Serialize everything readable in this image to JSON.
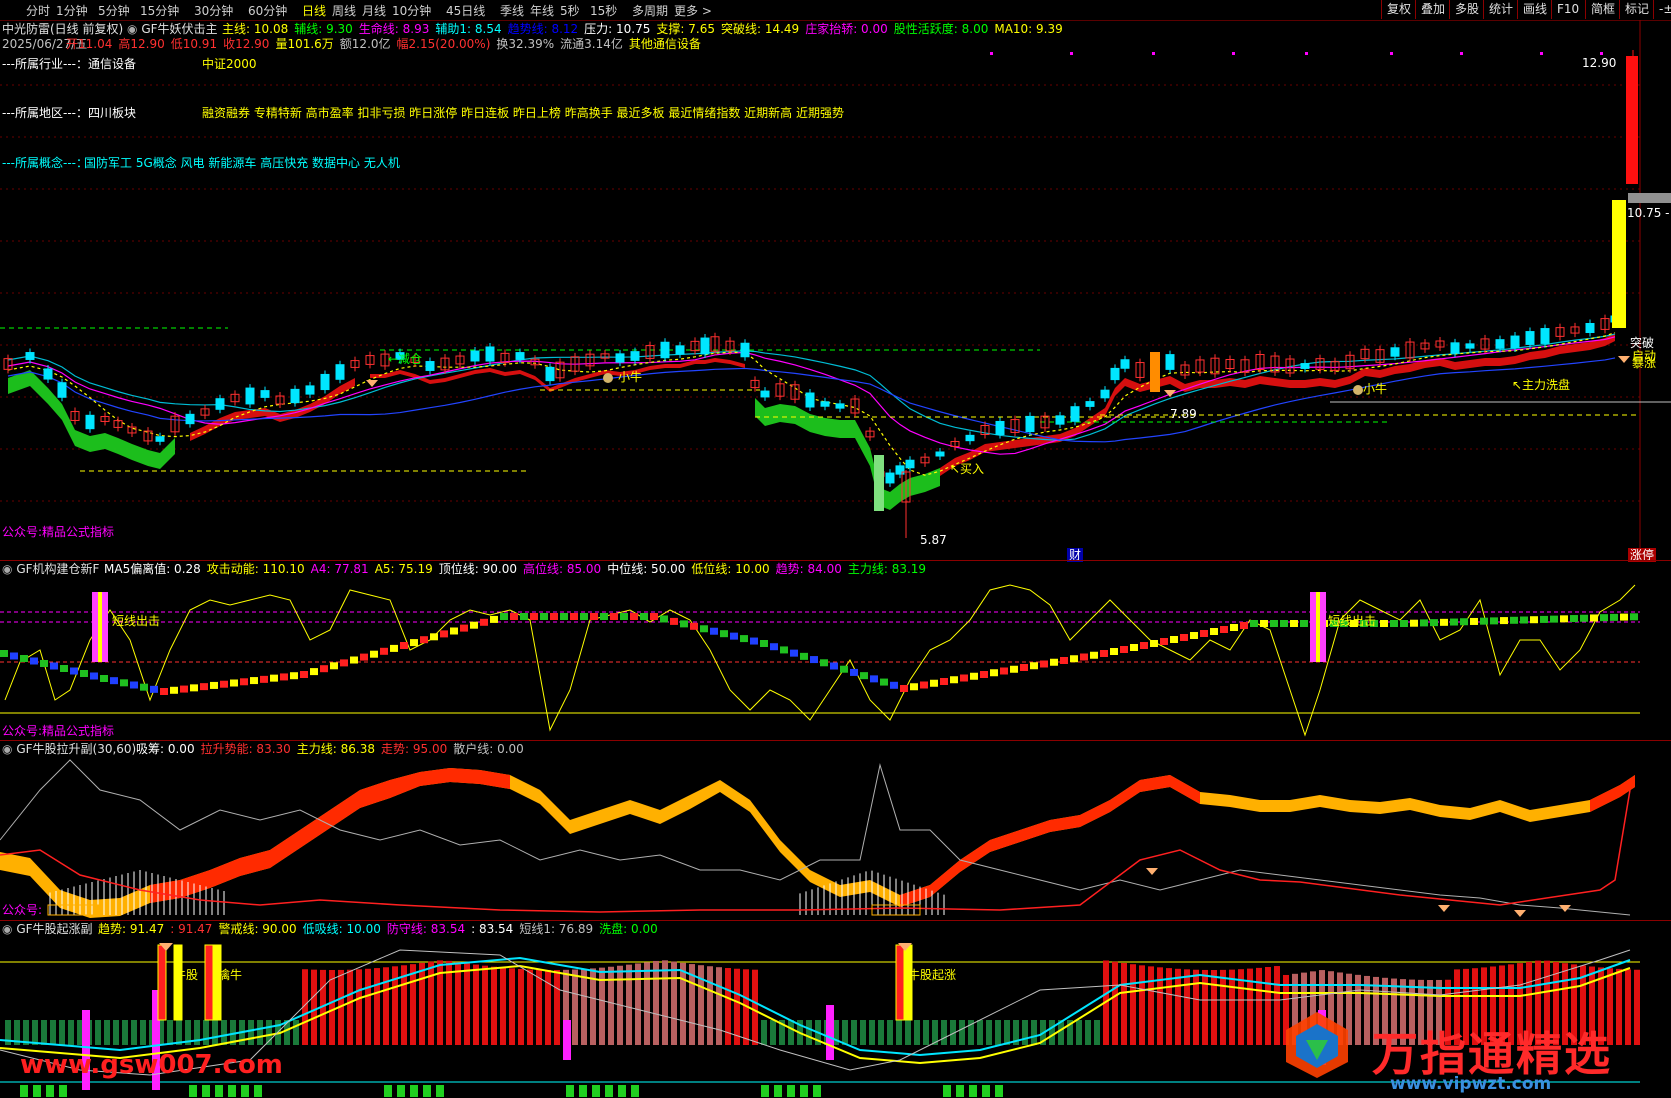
{
  "toolbar": {
    "periods": [
      "分时",
      "1分钟",
      "5分钟",
      "15分钟",
      "30分钟",
      "60分钟",
      "日线",
      "周线",
      "月线",
      "10分钟",
      "45日线",
      "季线",
      "年线",
      "5秒",
      "15秒",
      "多周期",
      "更多 >"
    ],
    "active": "日线",
    "right_buttons": [
      "复权",
      "叠加",
      "多股",
      "统计",
      "画线",
      "F10",
      "简框",
      "标记",
      "-±"
    ]
  },
  "stock": {
    "title": "中光防雷(日线 前复权)",
    "indicator_name": "GF牛妖伏击主",
    "lines": [
      {
        "label": "主线: 10.08",
        "color": "#ffff00"
      },
      {
        "label": "辅线: 9.30",
        "color": "#00ff00"
      },
      {
        "label": "生命线: 8.93",
        "color": "#ff00ff"
      },
      {
        "label": "辅助1: 8.54",
        "color": "#00ffff"
      },
      {
        "label": "趋势线: 8.12",
        "color": "#0000ff"
      },
      {
        "label": "压力: 10.75",
        "color": "#ffffff"
      },
      {
        "label": "支撑: 7.65",
        "color": "#ffff00"
      },
      {
        "label": "突破线: 14.49",
        "color": "#ffff00"
      },
      {
        "label": "庄家抬轿: 0.00",
        "color": "#ff00ff"
      },
      {
        "label": "股性活跃度: 8.00",
        "color": "#00ff00"
      },
      {
        "label": "MA10: 9.39",
        "color": "#ffff00"
      }
    ],
    "date": "2025/06/27/五",
    "quote": [
      {
        "label": "开11.04",
        "color": "#ff3030"
      },
      {
        "label": "高12.90",
        "color": "#ff3030"
      },
      {
        "label": "低10.91",
        "color": "#ff3030"
      },
      {
        "label": "收12.90",
        "color": "#ff3030"
      },
      {
        "label": "量101.6万",
        "color": "#ffff00"
      },
      {
        "label": "额12.0亿",
        "color": "#c0c0c0"
      },
      {
        "label": "幅2.15(20.00%)",
        "color": "#ff3030"
      },
      {
        "label": "换32.39%",
        "color": "#c0c0c0"
      },
      {
        "label": "流通3.14亿",
        "color": "#c0c0c0"
      },
      {
        "label": "其他通信设备",
        "color": "#ffff00"
      }
    ]
  },
  "info": {
    "industry_label": "---所属行业---：",
    "industry": "通信设备",
    "index": "中证2000",
    "region_label": "---所属地区---：",
    "region": "四川板块",
    "tags": "融资融券 专精特新 高市盈率 扣非亏损 昨日涨停 昨日连板 昨日上榜 昨高换手 最近多板 最近情绪指数 近期新高 近期强势",
    "concept_label": "---所属概念---：",
    "concepts": "国防军工 5G概念 风电 新能源车 高压快充 数据中心 无人机"
  },
  "main_chart": {
    "annotations": {
      "high": "12.90",
      "low": "5.87",
      "pressure": "10.75 - 1",
      "jiancang": "←减仓",
      "xiaoniu1": "小牛",
      "xiaoniu2": "小牛",
      "mairu": "↖买入",
      "zhuli": "↖主力洗盘",
      "tupo": "突破",
      "qidong": "启动",
      "zhangting": "暴涨",
      "price789": "7.89",
      "cai": "财",
      "zhangting_tag": "涨停",
      "footer": "公众号:精品公式指标"
    }
  },
  "panel2": {
    "name": "GF机构建仓新F",
    "vals": [
      {
        "label": "MA5偏离值: 0.28",
        "color": "#ffffff"
      },
      {
        "label": "攻击动能: 110.10",
        "color": "#ffff00"
      },
      {
        "label": "A4: 77.81",
        "color": "#ff00ff"
      },
      {
        "label": "A5: 75.19",
        "color": "#ffff00"
      },
      {
        "label": "顶位线: 90.00",
        "color": "#ffffff"
      },
      {
        "label": "高位线: 85.00",
        "color": "#ff00ff"
      },
      {
        "label": "中位线: 50.00",
        "color": "#ffffff"
      },
      {
        "label": "低位线: 10.00",
        "color": "#ffff00"
      },
      {
        "label": "趋势: 84.00",
        "color": "#ff00ff"
      },
      {
        "label": "主力线: 83.19",
        "color": "#00ff00"
      }
    ],
    "sig1": "短线出击",
    "sig2": "短线出击",
    "footer": "公众号:精品公式指标"
  },
  "panel3": {
    "name": "GF牛股拉升副(30,60)",
    "vals": [
      {
        "label": "吸筹: 0.00",
        "color": "#ffffff"
      },
      {
        "label": "拉升势能: 83.30",
        "color": "#ff3030"
      },
      {
        "label": "主力线: 86.38",
        "color": "#ffff00"
      },
      {
        "label": "走势: 95.00",
        "color": "#ff3030"
      },
      {
        "label": "散户线: 0.00",
        "color": "#c0c0c0"
      }
    ],
    "footer": "公众号:"
  },
  "panel4": {
    "name": "GF牛股起涨副",
    "vals": [
      {
        "label": "趋势: 91.47",
        "color": "#ffff00"
      },
      {
        "label": ": 91.47",
        "color": "#ff3030"
      },
      {
        "label": "警戒线: 90.00",
        "color": "#ffff00"
      },
      {
        "label": "低吸线: 10.00",
        "color": "#00ffff"
      },
      {
        "label": "防守线: 83.54",
        "color": "#ff00ff"
      },
      {
        "label": ": 83.54",
        "color": "#ffffff"
      },
      {
        "label": "短线1: 76.89",
        "color": "#c0c0c0"
      },
      {
        "label": "洗盘: 0.00",
        "color": "#00ff00"
      }
    ],
    "sig1": "牛股",
    "sig2": "擒牛",
    "sig3": "牛股起涨"
  },
  "watermarks": {
    "site1": "www.gsw007.com",
    "brand": "万指通精选",
    "site2": "www.vipwzt.com"
  }
}
